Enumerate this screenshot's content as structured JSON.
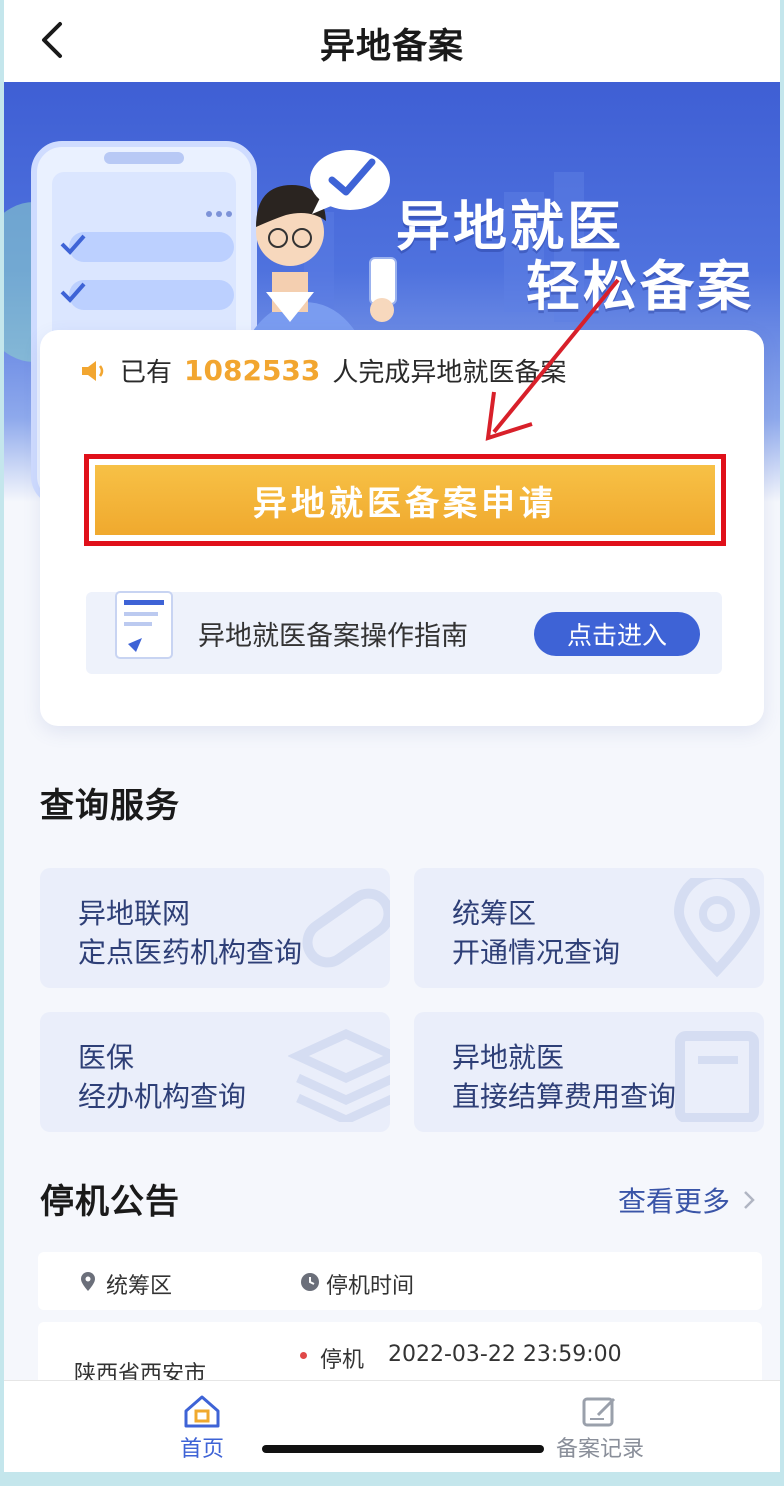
{
  "nav": {
    "title": "异地备案"
  },
  "banner": {
    "slogan_line1": "异地就医",
    "slogan_line2": "轻松备案"
  },
  "card": {
    "notice_prefix": "已有",
    "notice_count": "1082533",
    "notice_suffix": "人完成异地就医备案",
    "apply_button": "异地就医备案申请",
    "guide_text": "异地就医备案操作指南",
    "guide_button": "点击进入"
  },
  "query": {
    "title": "查询服务",
    "items": [
      {
        "line1": "异地联网",
        "line2": "定点医药机构查询",
        "icon": "pill-icon"
      },
      {
        "line1": "统筹区",
        "line2": "开通情况查询",
        "icon": "location-pin-icon"
      },
      {
        "line1": "医保",
        "line2": "经办机构查询",
        "icon": "layers-icon"
      },
      {
        "line1": "异地就医",
        "line2": "直接结算费用查询",
        "icon": "receipt-icon"
      }
    ]
  },
  "outage": {
    "title": "停机公告",
    "more": "查看更多",
    "col_region": "统筹区",
    "col_time": "停机时间",
    "row_region": "陕西省西安市",
    "row_label": "停机",
    "row_time": "2022-03-22 23:59:00"
  },
  "tabbar": {
    "home": "首页",
    "records": "备案记录"
  },
  "colors": {
    "primary": "#3e63d6",
    "apply": "#f0a92e",
    "highlight_border": "#e0101a",
    "count": "#f2a630",
    "arrow": "#d8202a"
  }
}
